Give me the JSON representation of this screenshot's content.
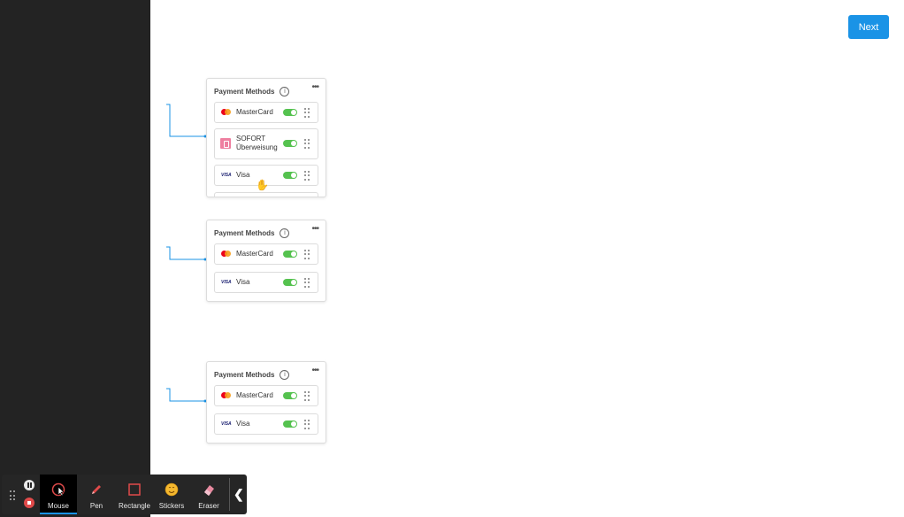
{
  "header": {
    "next_label": "Next"
  },
  "cards": [
    {
      "title": "Payment Methods",
      "info_icon": "info-icon",
      "menu_icon": "more-horizontal-icon",
      "rows": [
        {
          "label": "MasterCard",
          "logo": "mastercard-logo",
          "enabled": true
        },
        {
          "label": "SOFORT Überweisung",
          "logo": "sofort-logo",
          "enabled": true
        },
        {
          "label": "Visa",
          "logo": "visa-logo",
          "enabled": true
        }
      ]
    },
    {
      "title": "Payment Methods",
      "info_icon": "info-icon",
      "menu_icon": "more-horizontal-icon",
      "rows": [
        {
          "label": "MasterCard",
          "logo": "mastercard-logo",
          "enabled": true
        },
        {
          "label": "Visa",
          "logo": "visa-logo",
          "enabled": true
        }
      ]
    },
    {
      "title": "Payment Methods",
      "info_icon": "info-icon",
      "menu_icon": "more-horizontal-icon",
      "rows": [
        {
          "label": "MasterCard",
          "logo": "mastercard-logo",
          "enabled": true
        },
        {
          "label": "Visa",
          "logo": "visa-logo",
          "enabled": true
        }
      ]
    }
  ],
  "logos": {
    "visa_text": "VISA"
  },
  "toolbar": {
    "tools": [
      {
        "label": "Mouse",
        "icon": "mouse-pointer-icon",
        "active": true
      },
      {
        "label": "Pen",
        "icon": "pen-icon",
        "active": false
      },
      {
        "label": "Rectangle",
        "icon": "rectangle-icon",
        "active": false
      },
      {
        "label": "Stickers",
        "icon": "sticker-icon",
        "active": false
      },
      {
        "label": "Eraser",
        "icon": "eraser-icon",
        "active": false
      }
    ],
    "collapse_icon": "chevron-left-icon"
  },
  "colors": {
    "accent": "#1a93e6",
    "toggle_on": "#55c24f",
    "sidebar": "#232323",
    "toolbar": "#262626"
  }
}
